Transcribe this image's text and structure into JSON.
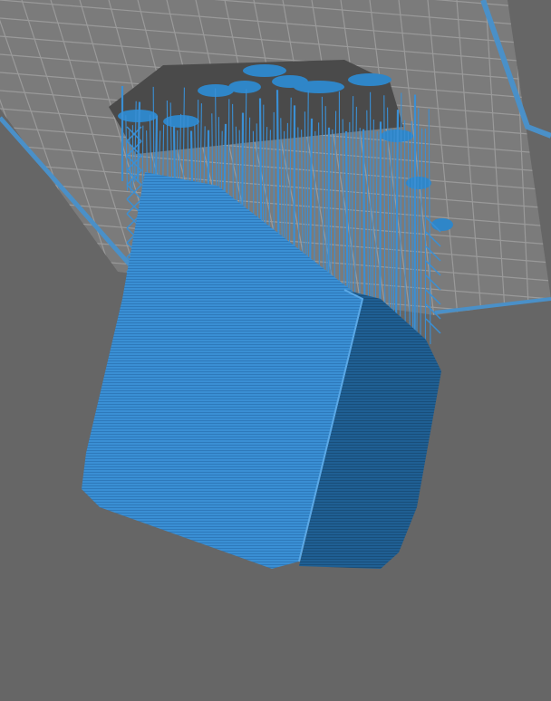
{
  "viewport": {
    "background_color": "#666666",
    "build_plate": {
      "grid_color": "#7b7b7b",
      "grid_line_color": "#9a9a9a",
      "border_color": "#4a90c8"
    },
    "model": {
      "color_light": "#3a8fd4",
      "color_dark": "#1f5f93",
      "color_edge": "#5aa8e6",
      "base_raft_color": "#4a4a4a"
    },
    "supports": {
      "color": "#3a8fd4",
      "pad_color": "#2f86c8"
    }
  }
}
